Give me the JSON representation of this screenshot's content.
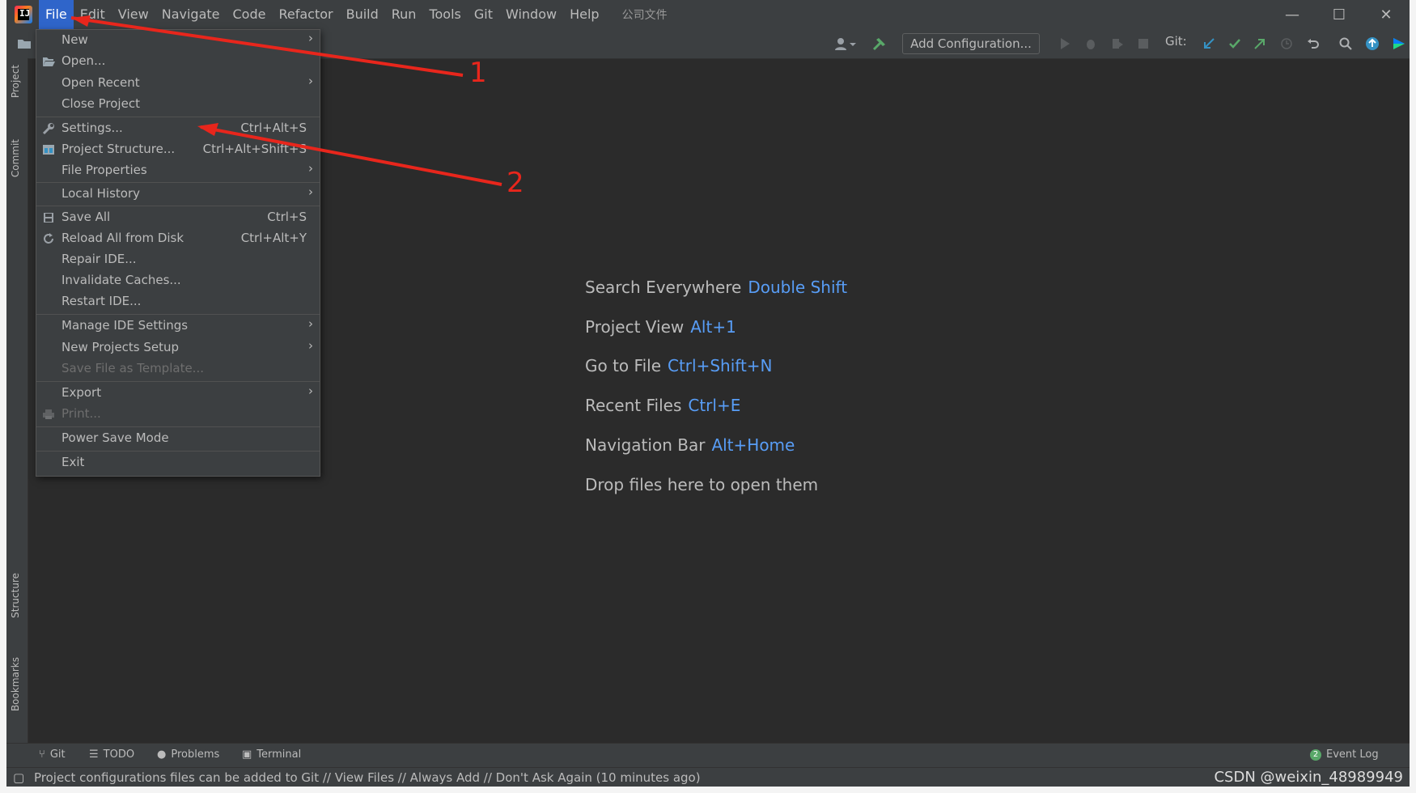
{
  "menubar": {
    "items": [
      "File",
      "Edit",
      "View",
      "Navigate",
      "Code",
      "Refactor",
      "Build",
      "Run",
      "Tools",
      "Git",
      "Window",
      "Help"
    ],
    "project_name": "公司文件"
  },
  "window_controls": {
    "minimize": "—",
    "maximize": "☐",
    "close": "✕"
  },
  "toolbar": {
    "add_configuration": "Add Configuration...",
    "git_label": "Git:"
  },
  "left_tabs": [
    "Project",
    "Commit",
    "Structure",
    "Bookmarks"
  ],
  "file_menu": {
    "items": [
      {
        "label": "New",
        "shortcut": "",
        "submenu": true
      },
      {
        "label": "Open...",
        "shortcut": "",
        "submenu": false
      },
      {
        "label": "Open Recent",
        "shortcut": "",
        "submenu": true
      },
      {
        "label": "Close Project",
        "shortcut": "",
        "submenu": false
      },
      {
        "label": "Settings...",
        "shortcut": "Ctrl+Alt+S",
        "submenu": false
      },
      {
        "label": "Project Structure...",
        "shortcut": "Ctrl+Alt+Shift+S",
        "submenu": false
      },
      {
        "label": "File Properties",
        "shortcut": "",
        "submenu": true
      },
      {
        "label": "Local History",
        "shortcut": "",
        "submenu": true
      },
      {
        "label": "Save All",
        "shortcut": "Ctrl+S",
        "submenu": false
      },
      {
        "label": "Reload All from Disk",
        "shortcut": "Ctrl+Alt+Y",
        "submenu": false
      },
      {
        "label": "Repair IDE...",
        "shortcut": "",
        "submenu": false
      },
      {
        "label": "Invalidate Caches...",
        "shortcut": "",
        "submenu": false
      },
      {
        "label": "Restart IDE...",
        "shortcut": "",
        "submenu": false
      },
      {
        "label": "Manage IDE Settings",
        "shortcut": "",
        "submenu": true
      },
      {
        "label": "New Projects Setup",
        "shortcut": "",
        "submenu": true
      },
      {
        "label": "Save File as Template...",
        "shortcut": "",
        "submenu": false
      },
      {
        "label": "Export",
        "shortcut": "",
        "submenu": true
      },
      {
        "label": "Print...",
        "shortcut": "",
        "submenu": false
      },
      {
        "label": "Power Save Mode",
        "shortcut": "",
        "submenu": false
      },
      {
        "label": "Exit",
        "shortcut": "",
        "submenu": false
      }
    ]
  },
  "welcome": {
    "hints": [
      {
        "label": "Search Everywhere",
        "key": "Double Shift"
      },
      {
        "label": "Project View",
        "key": "Alt+1"
      },
      {
        "label": "Go to File",
        "key": "Ctrl+Shift+N"
      },
      {
        "label": "Recent Files",
        "key": "Ctrl+E"
      },
      {
        "label": "Navigation Bar",
        "key": "Alt+Home"
      },
      {
        "label": "Drop files here to open them",
        "key": ""
      }
    ]
  },
  "bottom_tabs": [
    "Git",
    "TODO",
    "Problems",
    "Terminal"
  ],
  "event_log": {
    "badge": "2",
    "label": "Event Log"
  },
  "status": {
    "message": "Project configurations files can be added to Git // View Files // Always Add // Don't Ask Again (10 minutes ago)",
    "watermark": "CSDN @weixin_48989949"
  },
  "annotations": {
    "one": "1",
    "two": "2"
  },
  "colors": {
    "accent": "#2f65ca",
    "link": "#589df6",
    "arrow": "#e8261c",
    "bg": "#2b2b2b",
    "panel": "#3c3f41"
  }
}
